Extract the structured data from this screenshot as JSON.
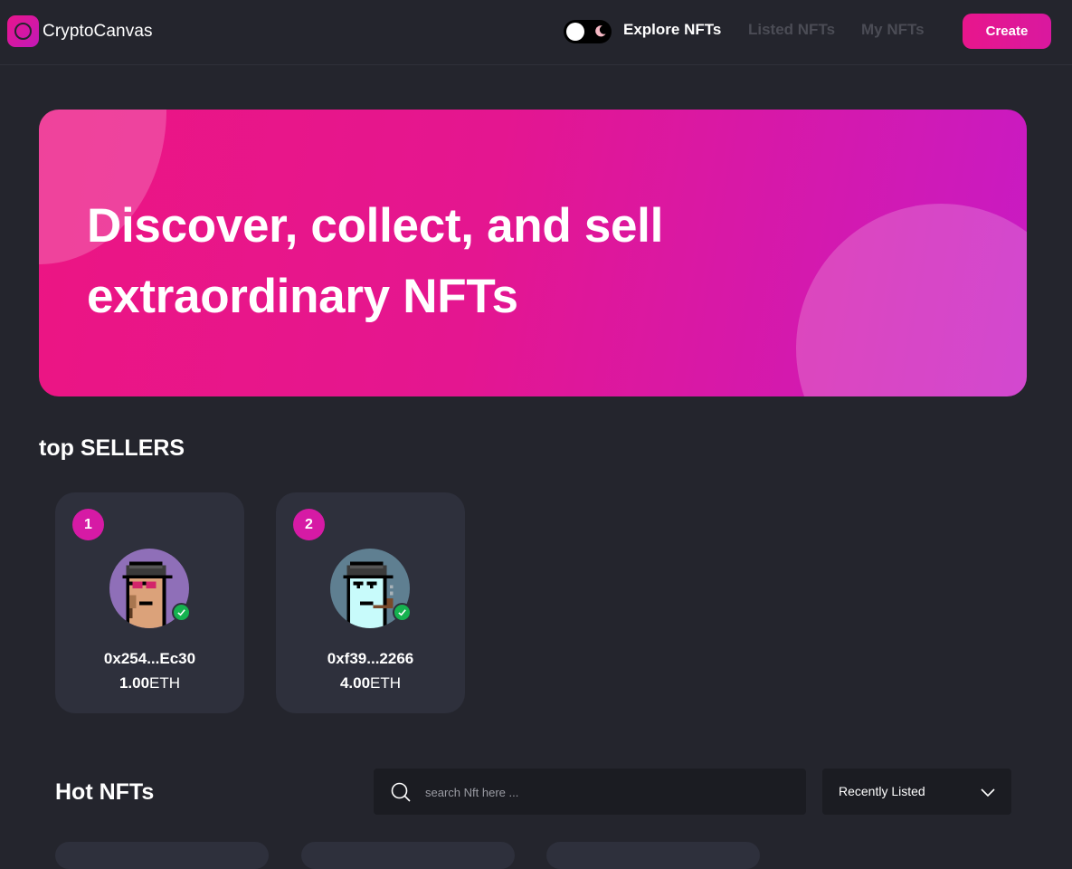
{
  "navbar": {
    "logo_text": "CryptoCanvas",
    "links": [
      "Explore NFTs",
      "Listed NFTs",
      "My NFTs"
    ],
    "create_label": "Create"
  },
  "hero": {
    "title_line1": "Discover, collect, and sell",
    "title_line2": "extraordinary NFTs"
  },
  "top_sellers": {
    "title": "top SELLERS",
    "sellers": [
      {
        "rank": "1",
        "address": "0x254...Ec30",
        "amount": "1.00",
        "unit": "ETH",
        "avatar_icon": "punk-avatar-purple"
      },
      {
        "rank": "2",
        "address": "0xf39...2266",
        "amount": "4.00",
        "unit": "ETH",
        "avatar_icon": "punk-avatar-slate"
      }
    ]
  },
  "hot_nfts": {
    "title": "Hot NFTs",
    "search_placeholder": "search Nft here ...",
    "sort_selected": "Recently Listed"
  },
  "colors": {
    "background": "#24252d",
    "accent": "#e8168c",
    "card": "#2e303c",
    "verified": "#16b250"
  }
}
